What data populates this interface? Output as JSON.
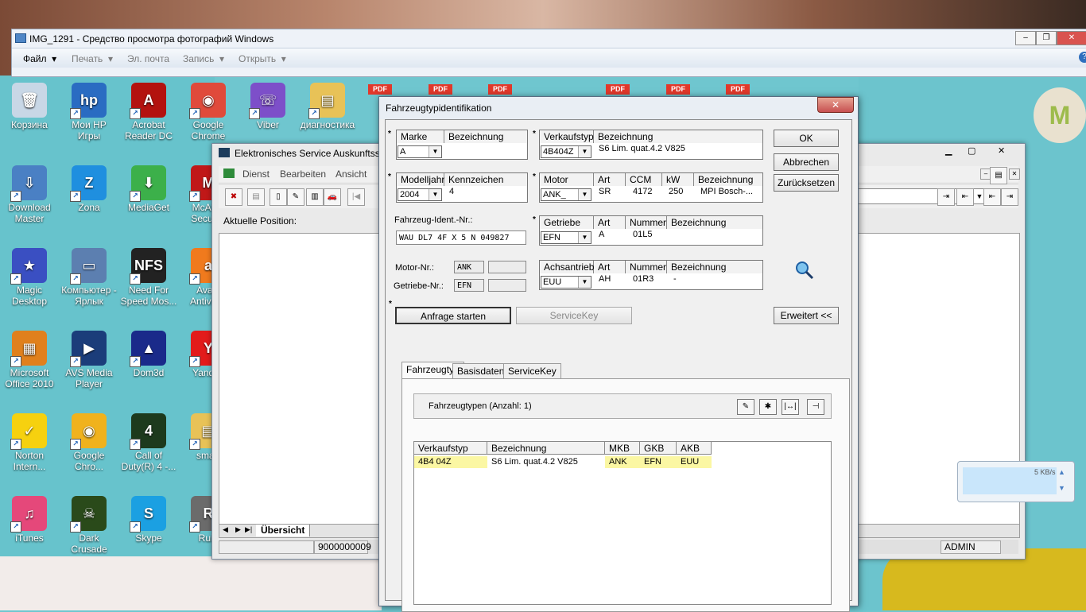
{
  "photo_viewer": {
    "title": "IMG_1291 - Средство просмотра фотографий Windows",
    "menu": [
      "Файл",
      "Печать",
      "Эл. почта",
      "Запись",
      "Открыть"
    ],
    "controls": [
      "–",
      "❐",
      "✕"
    ]
  },
  "desktop_icons": [
    {
      "label": "Корзина",
      "color": "#c8d7e6",
      "glyph": "🗑"
    },
    {
      "label": "Мои HP Игры",
      "color": "#2a6cc2",
      "glyph": "hp"
    },
    {
      "label": "Acrobat Reader DC",
      "color": "#b3120f",
      "glyph": "A"
    },
    {
      "label": "Google Chrome",
      "color": "#e04a3b",
      "glyph": "◉"
    },
    {
      "label": "Viber",
      "color": "#7d4fc9",
      "glyph": "☏"
    },
    {
      "label": "диагностика",
      "color": "#e8c257",
      "glyph": "▤"
    },
    {
      "label": "Download Master",
      "color": "#4a80c4",
      "glyph": "⇩"
    },
    {
      "label": "Zona",
      "color": "#1f8fdf",
      "glyph": "Z"
    },
    {
      "label": "MediaGet",
      "color": "#3cb04a",
      "glyph": "⬇"
    },
    {
      "label": "McAfee Security",
      "color": "#c01818",
      "glyph": "M"
    },
    {
      "label": "Magic Desktop",
      "color": "#3a4fc2",
      "glyph": "★"
    },
    {
      "label": "Компьютер - Ярлык",
      "color": "#5c7fb0",
      "glyph": "▭"
    },
    {
      "label": "Need For Speed Mos...",
      "color": "#222222",
      "glyph": "NFS"
    },
    {
      "label": "Avast Antivirus",
      "color": "#f07a1d",
      "glyph": "a"
    },
    {
      "label": "Microsoft Office 2010",
      "color": "#e0801d",
      "glyph": "▦"
    },
    {
      "label": "AVS Media Player",
      "color": "#1b3d7a",
      "glyph": "▶"
    },
    {
      "label": "Dom3d",
      "color": "#1a2a8a",
      "glyph": "▲"
    },
    {
      "label": "Yandex",
      "color": "#e21b1b",
      "glyph": "Y"
    },
    {
      "label": "Norton Intern...",
      "color": "#f6d10f",
      "glyph": "✓"
    },
    {
      "label": "Google Chro...",
      "color": "#f0b21d",
      "glyph": "◉"
    },
    {
      "label": "Call of Duty(R) 4 -...",
      "color": "#1d3a1d",
      "glyph": "4"
    },
    {
      "label": "smart",
      "color": "#e8c257",
      "glyph": "▤"
    },
    {
      "label": "iTunes",
      "color": "#e5487a",
      "glyph": "♫"
    },
    {
      "label": "Dark Crusade",
      "color": "#2a4a1a",
      "glyph": "☠"
    },
    {
      "label": "Skype",
      "color": "#1ba0e2",
      "glyph": "S"
    },
    {
      "label": "Ruin",
      "color": "#6b6b6b",
      "glyph": "R"
    }
  ],
  "pdf_badges": [
    "PDF",
    "PDF",
    "PDF",
    "PDF",
    "PDF",
    "PDF"
  ],
  "elsa": {
    "title": "Elektronisches Service Auskunftssy",
    "menu": [
      "Dienst",
      "Bearbeiten",
      "Ansicht"
    ],
    "position_label": "Aktuelle Position:",
    "tab": "Übersicht",
    "status_left": "9000000009",
    "status_right": "ADMIN"
  },
  "dialog": {
    "title": "Fahrzeugtypidentifikation",
    "close": "✕",
    "marke": {
      "hdr1": "Marke",
      "hdr2": "Bezeichnung",
      "value": "A"
    },
    "verkaufstyp": {
      "hdr1": "Verkaufstyp",
      "hdr2": "Bezeichnung",
      "value": "4B404Z",
      "desc": "S6 Lim. quat.4.2 V825"
    },
    "modelljahr": {
      "hdr1": "Modelljahr",
      "hdr2": "Kennzeichen",
      "value": "2004",
      "kennzeichen": "4"
    },
    "motor": {
      "hdr": [
        "Motor",
        "Art",
        "CCM",
        "kW",
        "Bezeichnung"
      ],
      "value": "ANK_",
      "art": "SR",
      "ccm": "4172",
      "kw": "250",
      "bez": "MPI Bosch-..."
    },
    "fin_label": "Fahrzeug-Ident.-Nr.:",
    "fin_value": "WAU DL7 4F X 5 N 049827",
    "getriebe": {
      "hdr": [
        "Getriebe",
        "Art",
        "Nummer",
        "Bezeichnung"
      ],
      "value": "EFN",
      "art": "A",
      "nummer": "01L5"
    },
    "motor_nr_label": "Motor-Nr.:",
    "motor_nr_value": "ANK",
    "getriebe_nr_label": "Getriebe-Nr.:",
    "getriebe_nr_value": "EFN",
    "achsantrieb": {
      "hdr": [
        "Achsantrieb",
        "Art",
        "Nummer",
        "Bezeichnung"
      ],
      "value": "EUU",
      "art": "AH",
      "nummer": "01R3",
      "bez": "-"
    },
    "buttons": {
      "ok": "OK",
      "abbrechen": "Abbrechen",
      "zuruecksetzen": "Zurücksetzen",
      "erweitert": "Erweitert <<",
      "anfrage": "Anfrage starten",
      "servicekey": "ServiceKey"
    },
    "tabs": [
      "Fahrzeugtyp",
      "Basisdaten",
      "ServiceKey"
    ],
    "fahrzeugtypen_label": "Fahrzeugtypen (Anzahl: 1)",
    "table": {
      "columns": [
        "Verkaufstyp",
        "Bezeichnung",
        "MKB",
        "GKB",
        "AKB"
      ],
      "rows": [
        [
          "4B4 04Z",
          "S6 Lim. quat.4.2 V825",
          "ANK",
          "EFN",
          "EUU"
        ]
      ]
    }
  },
  "network_widget": {
    "speed": "5 KB/s"
  }
}
